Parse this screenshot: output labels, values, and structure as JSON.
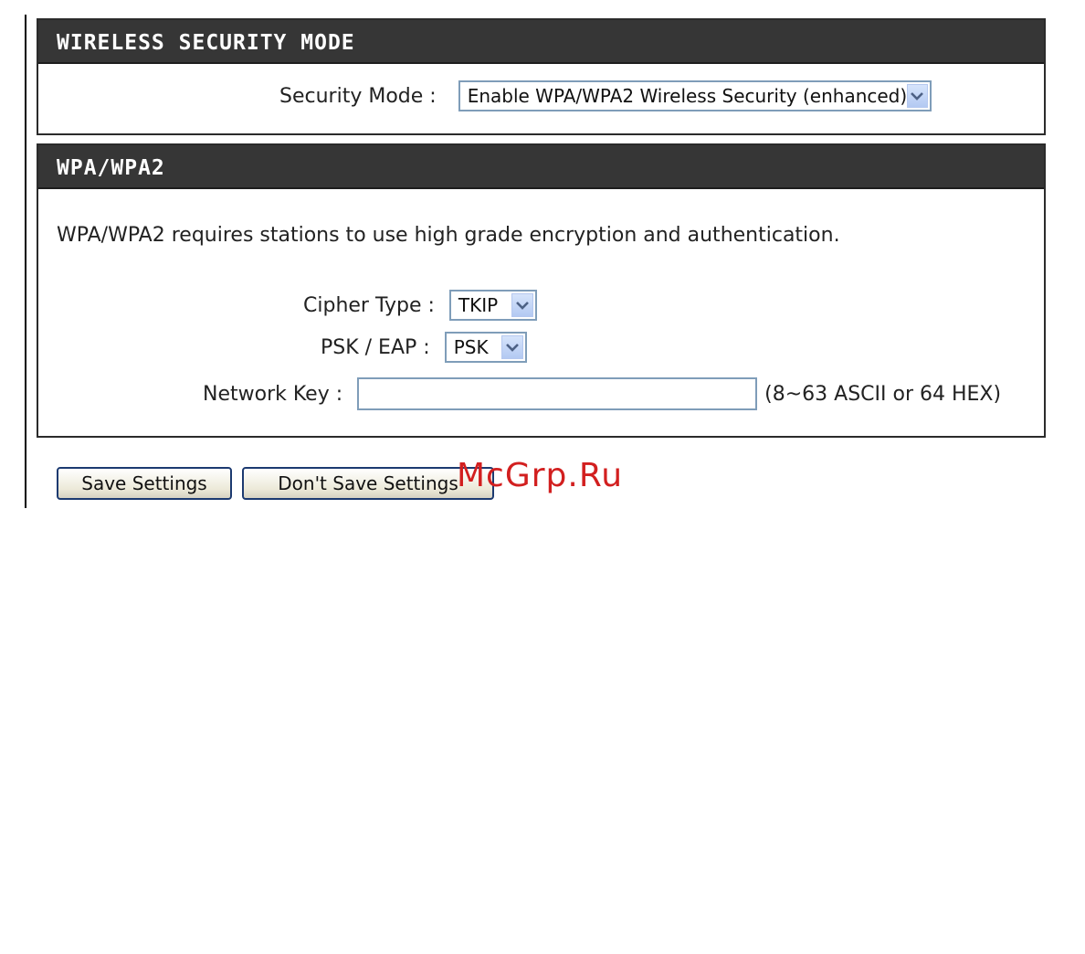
{
  "wireless_security_mode": {
    "header": "WIRELESS SECURITY MODE",
    "security_mode_label": "Security Mode :",
    "security_mode_value": "Enable WPA/WPA2 Wireless Security (enhanced)"
  },
  "wpa": {
    "header": "WPA/WPA2",
    "description": "WPA/WPA2 requires stations to use high grade encryption and authentication.",
    "cipher_type_label": "Cipher Type :",
    "cipher_type_value": "TKIP",
    "psk_eap_label": "PSK / EAP :",
    "psk_eap_value": "PSK",
    "network_key_label": "Network Key :",
    "network_key_value": "",
    "network_key_hint": "(8~63 ASCII or 64 HEX)"
  },
  "buttons": {
    "save_label": "Save Settings",
    "dont_save_label": "Don't Save Settings"
  },
  "watermark": "McGrp.Ru",
  "colors": {
    "header_bg": "#363636",
    "header_text": "#ffffff",
    "input_border": "#7f9db9",
    "watermark": "#d21f1f"
  },
  "icons": {
    "dropdown_arrow": "chevron-down-icon"
  }
}
